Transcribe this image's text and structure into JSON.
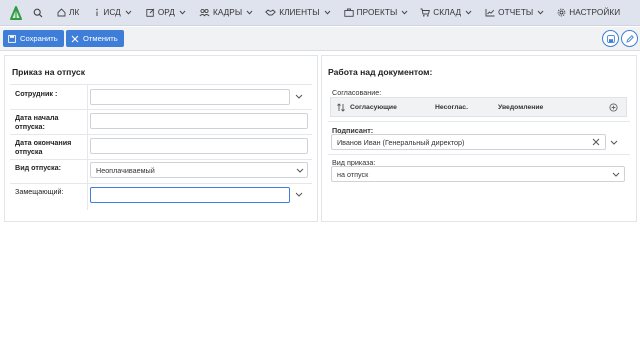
{
  "nav": {
    "items": [
      {
        "label": "ЛК",
        "icon": "home-icon",
        "has_menu": false
      },
      {
        "label": "ИСД",
        "icon": "info-icon",
        "has_menu": true
      },
      {
        "label": "ОРД",
        "icon": "edit-doc-icon",
        "has_menu": true
      },
      {
        "label": "КАДРЫ",
        "icon": "people-icon",
        "has_menu": true
      },
      {
        "label": "КЛИЕНТЫ",
        "icon": "handshake-icon",
        "has_menu": true
      },
      {
        "label": "ПРОЕКТЫ",
        "icon": "briefcase-icon",
        "has_menu": true
      },
      {
        "label": "СКЛАД",
        "icon": "cart-icon",
        "has_menu": true
      },
      {
        "label": "ОТЧЕТЫ",
        "icon": "chart-icon",
        "has_menu": true
      },
      {
        "label": "НАСТРОЙКИ",
        "icon": "gear-icon",
        "has_menu": false
      }
    ],
    "accent": "#2e9e3e"
  },
  "toolbar": {
    "save_label": "Сохранить",
    "cancel_label": "Отменить",
    "button_color": "#3f7ed8"
  },
  "left_panel": {
    "title": "Приказ на отпуск",
    "employee_label": "Сотрудник :",
    "employee_value": "",
    "start_label": "Дата начала отпуска:",
    "start_value": "",
    "end_label": "Дата окончания отпуска",
    "end_value": "",
    "type_label": "Вид отпуска:",
    "type_value": "Неоплачиваемый",
    "deputy_label": "Замещающий:",
    "deputy_value": ""
  },
  "right_panel": {
    "title": "Работа над документом:",
    "approval_label": "Согласование:",
    "approval_columns": [
      "Согласующие",
      "Несоглас.",
      "Уведомление"
    ],
    "signer_label": "Подписант:",
    "signer_value": "Иванов Иван  (Генеральный директор)",
    "order_type_label": "Вид приказа:",
    "order_type_value": "на отпуск"
  }
}
